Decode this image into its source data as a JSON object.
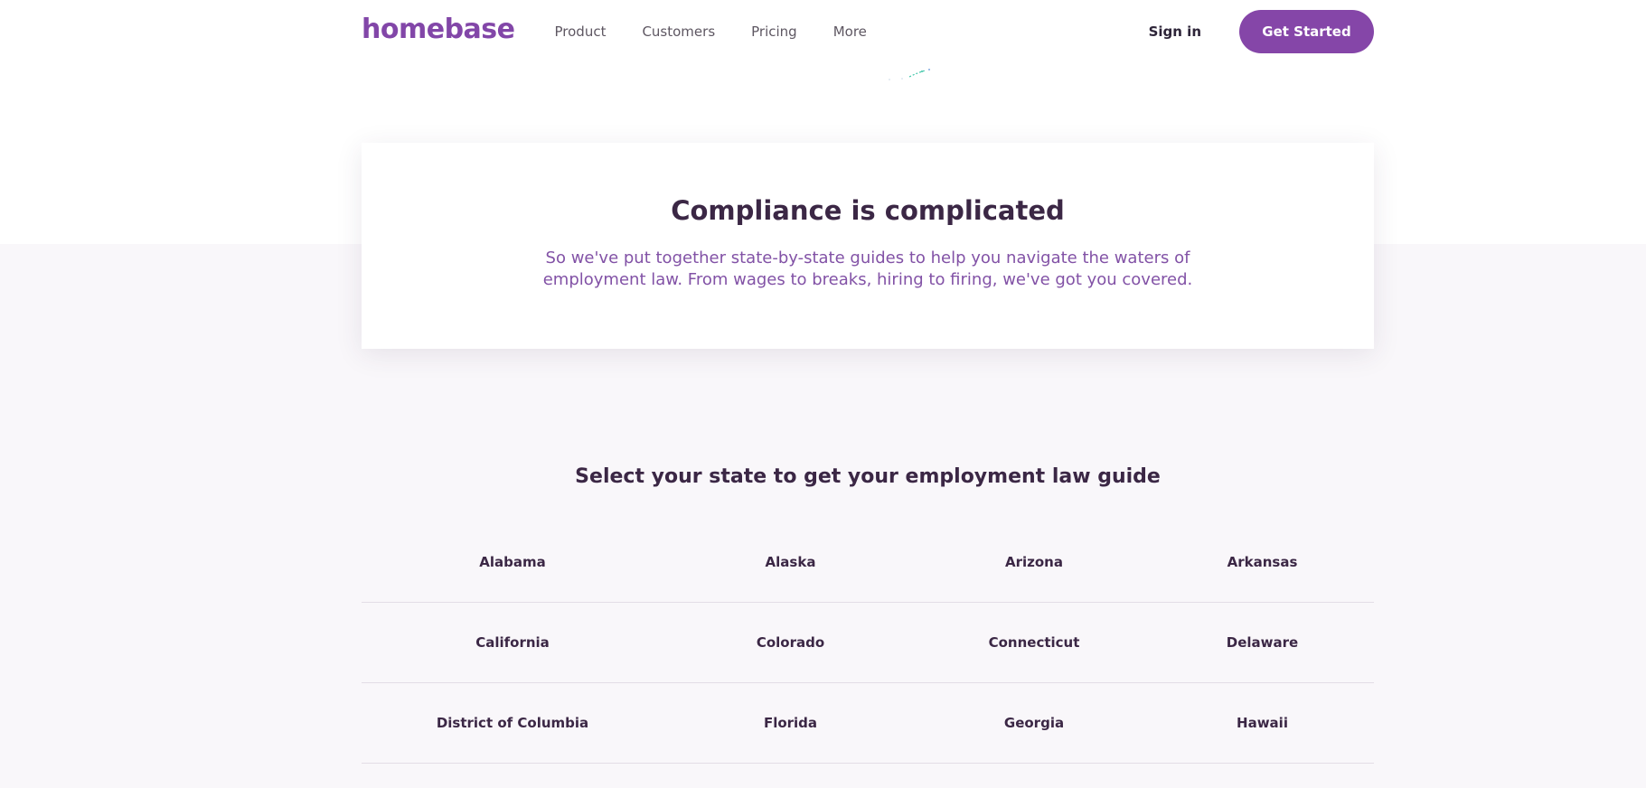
{
  "brand": {
    "logo": "homebase",
    "accent_color": "#8546a8"
  },
  "nav": {
    "links": [
      "Product",
      "Customers",
      "Pricing",
      "More"
    ],
    "sign_in": "Sign in",
    "cta": "Get Started"
  },
  "hero": {
    "title": "Compliance is complicated",
    "subtitle": "So we've put together state-by-state guides to help you navigate the waters of employment law. From wages to breaks, hiring to firing, we've got you covered."
  },
  "states_section": {
    "title": "Select your state to get your employment law guide",
    "rows": [
      [
        "Alabama",
        "Alaska",
        "Arizona",
        "Arkansas"
      ],
      [
        "California",
        "Colorado",
        "Connecticut",
        "Delaware"
      ],
      [
        "District of Columbia",
        "Florida",
        "Georgia",
        "Hawaii"
      ]
    ]
  }
}
